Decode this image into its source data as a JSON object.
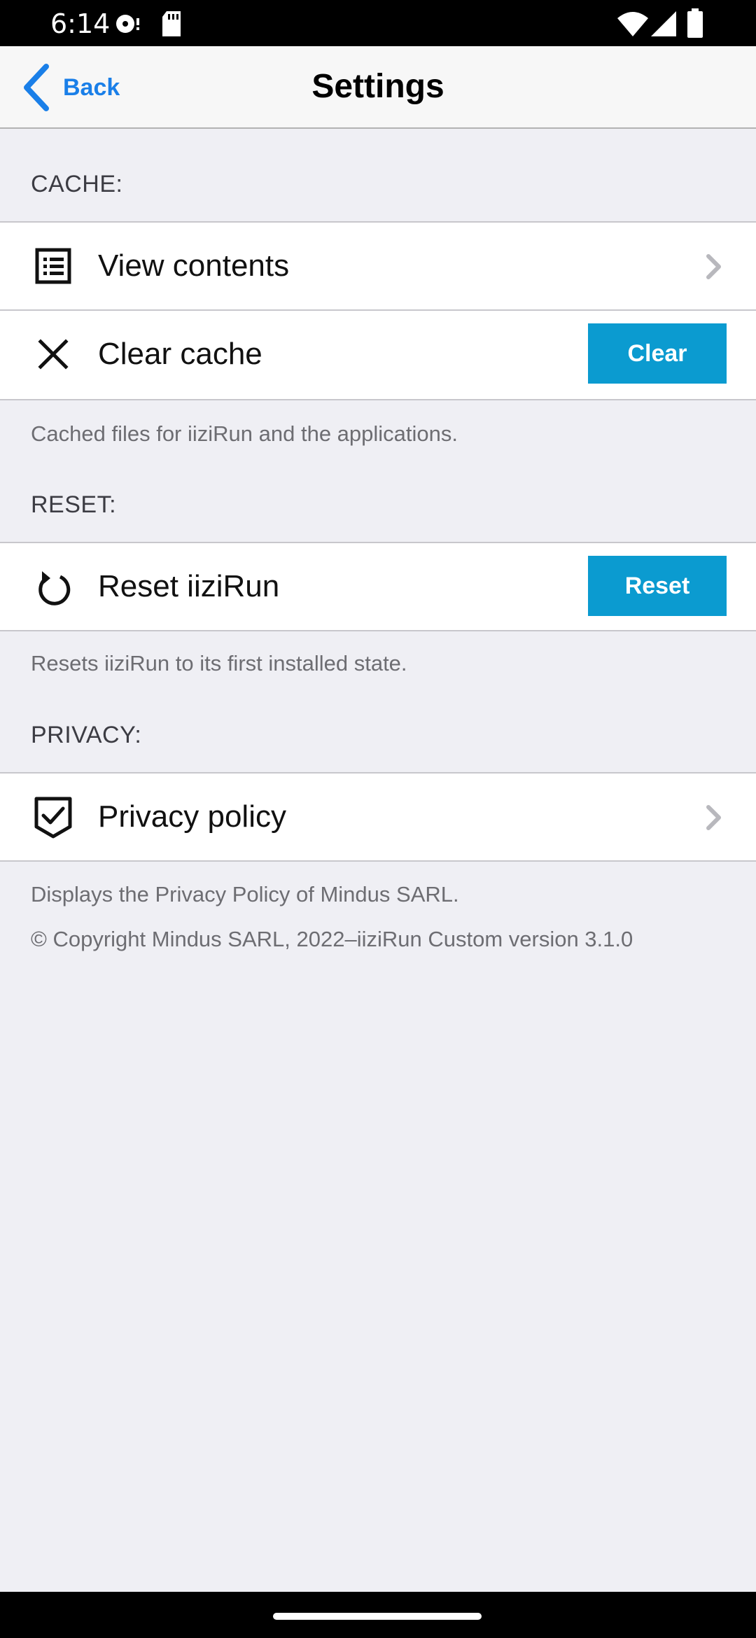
{
  "status_bar": {
    "time": "6:14",
    "icons": [
      "media-icon",
      "sd-card-icon",
      "wifi-icon",
      "signal-icon",
      "battery-icon"
    ]
  },
  "nav": {
    "back_label": "Back",
    "title": "Settings",
    "accent_color": "#1a7fe8"
  },
  "sections": {
    "cache": {
      "header": "CACHE:",
      "view_contents": {
        "label": "View contents",
        "icon": "list-icon"
      },
      "clear_cache": {
        "label": "Clear cache",
        "icon": "close-icon",
        "button_label": "Clear"
      },
      "footer": "Cached files for iiziRun and the applications."
    },
    "reset": {
      "header": "RESET:",
      "reset_row": {
        "label": "Reset iiziRun",
        "icon": "refresh-icon",
        "button_label": "Reset"
      },
      "footer": "Resets iiziRun to its first installed state."
    },
    "privacy": {
      "header": "PRIVACY:",
      "privacy_row": {
        "label": "Privacy policy",
        "icon": "shield-check-icon"
      },
      "footer": "Displays the Privacy Policy of Mindus SARL.",
      "copyright": "© Copyright Mindus SARL, 2022–iiziRun Custom version 3.1.0"
    }
  },
  "colors": {
    "background": "#efeff4",
    "button": "#0b9bd0"
  }
}
